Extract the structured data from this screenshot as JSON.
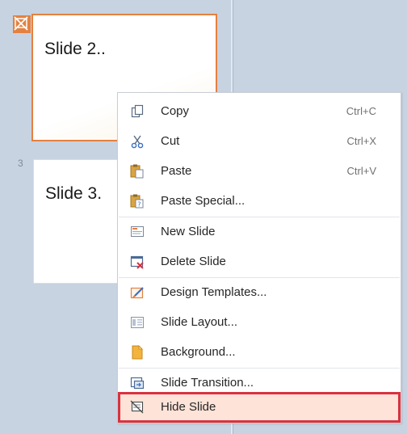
{
  "slides": [
    {
      "title": "Slide 2..",
      "selected": true,
      "hidden_badge": true
    },
    {
      "number": "3",
      "title": "Slide 3."
    }
  ],
  "context_menu": {
    "items": [
      {
        "label": "Copy",
        "shortcut": "Ctrl+C",
        "icon": "copy-icon"
      },
      {
        "label": "Cut",
        "shortcut": "Ctrl+X",
        "icon": "scissors-icon"
      },
      {
        "label": "Paste",
        "shortcut": "Ctrl+V",
        "icon": "paste-icon"
      },
      {
        "label": "Paste Special...",
        "icon": "paste-special-icon"
      },
      {
        "label": "New Slide",
        "icon": "new-slide-icon"
      },
      {
        "label": "Delete Slide",
        "icon": "delete-slide-icon"
      },
      {
        "label": "Design Templates...",
        "icon": "design-templates-icon"
      },
      {
        "label": "Slide Layout...",
        "icon": "slide-layout-icon"
      },
      {
        "label": "Background...",
        "icon": "background-icon"
      },
      {
        "label": "Slide Transition...",
        "icon": "slide-transition-icon"
      },
      {
        "label": "Hide Slide",
        "icon": "hide-slide-icon",
        "highlighted": true
      }
    ]
  },
  "colors": {
    "pane_background": "#c8d3e1",
    "selection_border": "#e48140",
    "highlight_fill": "#fde3d8",
    "highlight_outline": "#d9323f"
  }
}
